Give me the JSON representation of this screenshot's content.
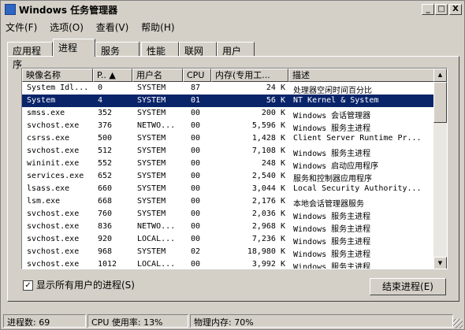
{
  "window": {
    "title": "Windows 任务管理器"
  },
  "titlebar_buttons": {
    "minimize": "_",
    "maximize": "□",
    "close": "X"
  },
  "menu": [
    "文件(F)",
    "选项(O)",
    "查看(V)",
    "帮助(H)"
  ],
  "tabs": [
    "应用程序",
    "进程",
    "服务",
    "性能",
    "联网",
    "用户"
  ],
  "active_tab": "进程",
  "columns": [
    "映像名称",
    "P.. ▲",
    "用户名",
    "CPU",
    "内存(专用工...",
    "描述"
  ],
  "processes": [
    {
      "name": "System Idl...",
      "pid": "0",
      "user": "SYSTEM",
      "cpu": "87",
      "mem": "24 K",
      "desc": "处理器空闲时间百分比"
    },
    {
      "name": "System",
      "pid": "4",
      "user": "SYSTEM",
      "cpu": "01",
      "mem": "56 K",
      "desc": "NT Kernel & System"
    },
    {
      "name": "smss.exe",
      "pid": "352",
      "user": "SYSTEM",
      "cpu": "00",
      "mem": "200 K",
      "desc": "Windows 会话管理器"
    },
    {
      "name": "svchost.exe",
      "pid": "376",
      "user": "NETWO...",
      "cpu": "00",
      "mem": "5,596 K",
      "desc": "Windows 服务主进程"
    },
    {
      "name": "csrss.exe",
      "pid": "500",
      "user": "SYSTEM",
      "cpu": "00",
      "mem": "1,428 K",
      "desc": "Client Server Runtime Pr..."
    },
    {
      "name": "svchost.exe",
      "pid": "512",
      "user": "SYSTEM",
      "cpu": "00",
      "mem": "7,108 K",
      "desc": "Windows 服务主进程"
    },
    {
      "name": "wininit.exe",
      "pid": "552",
      "user": "SYSTEM",
      "cpu": "00",
      "mem": "248 K",
      "desc": "Windows 启动应用程序"
    },
    {
      "name": "services.exe",
      "pid": "652",
      "user": "SYSTEM",
      "cpu": "00",
      "mem": "2,540 K",
      "desc": "服务和控制器应用程序"
    },
    {
      "name": "lsass.exe",
      "pid": "660",
      "user": "SYSTEM",
      "cpu": "00",
      "mem": "3,044 K",
      "desc": "Local Security Authority..."
    },
    {
      "name": "lsm.exe",
      "pid": "668",
      "user": "SYSTEM",
      "cpu": "00",
      "mem": "2,176 K",
      "desc": "本地会话管理器服务"
    },
    {
      "name": "svchost.exe",
      "pid": "760",
      "user": "SYSTEM",
      "cpu": "00",
      "mem": "2,036 K",
      "desc": "Windows 服务主进程"
    },
    {
      "name": "svchost.exe",
      "pid": "836",
      "user": "NETWO...",
      "cpu": "00",
      "mem": "2,968 K",
      "desc": "Windows 服务主进程"
    },
    {
      "name": "svchost.exe",
      "pid": "920",
      "user": "LOCAL...",
      "cpu": "00",
      "mem": "7,236 K",
      "desc": "Windows 服务主进程"
    },
    {
      "name": "svchost.exe",
      "pid": "968",
      "user": "SYSTEM",
      "cpu": "02",
      "mem": "18,980 K",
      "desc": "Windows 服务主进程"
    },
    {
      "name": "svchost.exe",
      "pid": "1012",
      "user": "LOCAL...",
      "cpu": "00",
      "mem": "3,992 K",
      "desc": "Windows 服务主进程"
    }
  ],
  "selected_row": 1,
  "show_all_users": {
    "label": "显示所有用户的进程(S)",
    "checked": "✓"
  },
  "end_process_button": "结束进程(E)",
  "status": {
    "processes": "进程数: 69",
    "cpu": "CPU 使用率: 13%",
    "memory": "物理内存: 70%"
  }
}
